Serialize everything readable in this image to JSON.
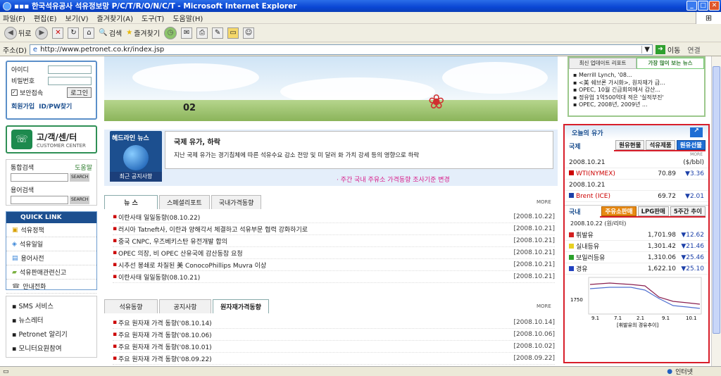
{
  "window": {
    "title": "▪▪▪ 한국석유공사 석유정보망 P/C/T/R/O/N/C/T - Microsoft Internet Explorer"
  },
  "menu": [
    "파일(F)",
    "편집(E)",
    "보기(V)",
    "즐겨찾기(A)",
    "도구(T)",
    "도움말(H)"
  ],
  "toolbar": {
    "back": "뒤로",
    "search": "검색",
    "favorites": "즐겨찾기"
  },
  "address": {
    "label": "주소(D)",
    "url": "http://www.petronet.co.kr/index.jsp",
    "go": "이동",
    "links": "연결"
  },
  "login": {
    "id_label": "아이디",
    "pw_label": "비밀번호",
    "secure": "보안접속",
    "login_btn": "로그인",
    "join": "회원가입",
    "find": "ID/PW찾기"
  },
  "customer": {
    "title": "고/객/센/터",
    "sub": "CUSTOMER CENTER"
  },
  "search": {
    "label1": "통합검색",
    "help": "도움말",
    "label2": "용어검색",
    "btn": "SEARCH"
  },
  "quick": {
    "title": "QUICK LINK",
    "items": [
      "석유정책",
      "석유일일",
      "용어사전",
      "석유판매관련신고",
      "안내전화"
    ]
  },
  "services": [
    "SMS 서비스",
    "뉴스레터",
    "Petronet 알리기",
    "모니터요원참여"
  ],
  "banner": {
    "text": "02"
  },
  "headline": {
    "badge": "헤드라인 뉴스",
    "title": "국제 유가, 하락",
    "body": "지난 국제 유가는 경기침체에 따른 석유수요 감소 전망 및 미 달러 화 가치 강세 등의 영향으로 하락",
    "notice": "최근 공지사항",
    "ticker": "· 주간 국내 주유소 가격동향 조사기준 변경"
  },
  "news_tabs": [
    "뉴 스",
    "스페셜리포트",
    "국내가격동향"
  ],
  "more": "MORE",
  "news": [
    {
      "t": "이란사태 일일동향(08.10.22)",
      "d": "[2008.10.22]"
    },
    {
      "t": "러시아 Tatneft사, 이란과 양해각서 체결하고 석유부문 협력 강화하기로",
      "d": "[2008.10.21]"
    },
    {
      "t": "중국 CNPC, 우즈베키스탄 유전개발 합의",
      "d": "[2008.10.21]"
    },
    {
      "t": "OPEC 의장, 비 OPEC 산유국에 감산동참 요청",
      "d": "[2008.10.21]"
    },
    {
      "t": "시추선 봉쇄로 차질된 美 ConocoPhillips Muvra 이상",
      "d": "[2008.10.21]"
    },
    {
      "t": "이란사태 일일동향(08.10.21)",
      "d": "[2008.10.21]"
    }
  ],
  "oil_tabs": [
    "석유동향",
    "공지사항",
    "원자재가격동향"
  ],
  "oil": [
    {
      "t": "주요 원자재 가격 동향('08.10.14)",
      "d": "[2008.10.14]"
    },
    {
      "t": "주요 원자재 가격 동향('08.10.06)",
      "d": "[2008.10.06]"
    },
    {
      "t": "주요 원자재 가격 동향('08.10.01)",
      "d": "[2008.10.02]"
    },
    {
      "t": "주요 원자재 가격 동향('08.09.22)",
      "d": "[2008.09.22]"
    }
  ],
  "right_tabs": [
    "최신 업데이트 리포트",
    "가장 많이 보는 뉴스"
  ],
  "right_news": [
    "Merrill Lynch, '08...",
    "<美 쉐브론 가시화>, 원자재가 급...",
    "OPEC, 10월 긴급회의에서 감산...",
    "정유업 1억500억대 적은 '실적부진'",
    "OPEC, 2008년, 2009년 ..."
  ],
  "price": {
    "title": "오늘의 유가",
    "intl": "국제",
    "intl_tabs": [
      "원유현물",
      "석유제품",
      "원유선물"
    ],
    "more": "MORE",
    "d1": "2008.10.21",
    "unit": "($/bbl)",
    "r1": {
      "n": "WTI(NYMEX)",
      "v": "70.89",
      "c": "▼3.36"
    },
    "d2": "2008.10.21",
    "r2": {
      "n": "Brent (ICE)",
      "v": "69.72",
      "c": "▼2.01"
    },
    "dom": "국내",
    "dom_tabs": [
      "주유소판매",
      "LPG판매",
      "5주간 추이"
    ],
    "dom_date": "2008.10.22 (원/리터)",
    "rows": [
      {
        "n": "휘발유",
        "v": "1,701.98",
        "c": "▼12.62",
        "color": "#d42020"
      },
      {
        "n": "실내등유",
        "v": "1,301.42",
        "c": "▼21.46",
        "color": "#e8d020"
      },
      {
        "n": "보일러등유",
        "v": "1,310.06",
        "c": "▼25.46",
        "color": "#2aa02a"
      },
      {
        "n": "경유",
        "v": "1,622.10",
        "c": "▼25.10",
        "color": "#2040c0"
      }
    ],
    "chart_ylabel": "1750",
    "chart_x": [
      "9.1",
      "7.1",
      "2.1",
      "9.1",
      "10.1"
    ],
    "chart_caption": "[휘발유의 경유추이]"
  },
  "status": {
    "zone": "인터넷"
  }
}
